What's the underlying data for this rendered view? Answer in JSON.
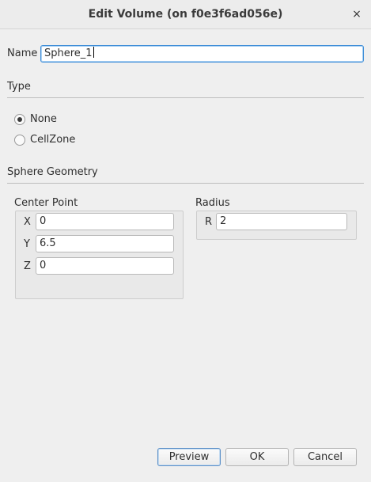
{
  "window": {
    "title": "Edit Volume (on f0e3f6ad056e)",
    "close_glyph": "×"
  },
  "name": {
    "label": "Name",
    "value": "Sphere_1"
  },
  "type": {
    "heading": "Type",
    "options": [
      {
        "label": "None",
        "checked": true
      },
      {
        "label": "CellZone",
        "checked": false
      }
    ]
  },
  "geometry": {
    "heading": "Sphere Geometry",
    "center": {
      "title": "Center Point",
      "x_label": "X",
      "x_value": "0",
      "y_label": "Y",
      "y_value": "6.5",
      "z_label": "Z",
      "z_value": "0"
    },
    "radius": {
      "title": "Radius",
      "r_label": "R",
      "r_value": "2"
    }
  },
  "buttons": {
    "preview": "Preview",
    "ok": "OK",
    "cancel": "Cancel"
  }
}
